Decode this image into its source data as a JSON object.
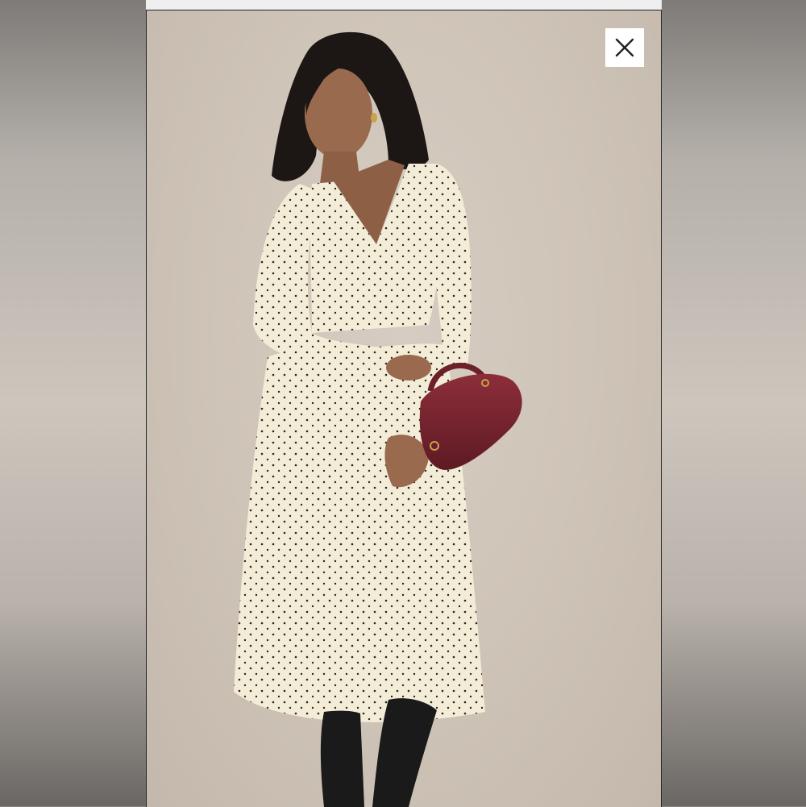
{
  "viewer": {
    "close_button": {
      "icon": "close-icon"
    }
  },
  "colors": {
    "backdrop": "#cfc4b8",
    "dress": "#f3ecd7",
    "bag": "#7a2430",
    "boots": "#1a1a1a",
    "hair": "#1c1714",
    "skin": "#9a6a4e"
  }
}
